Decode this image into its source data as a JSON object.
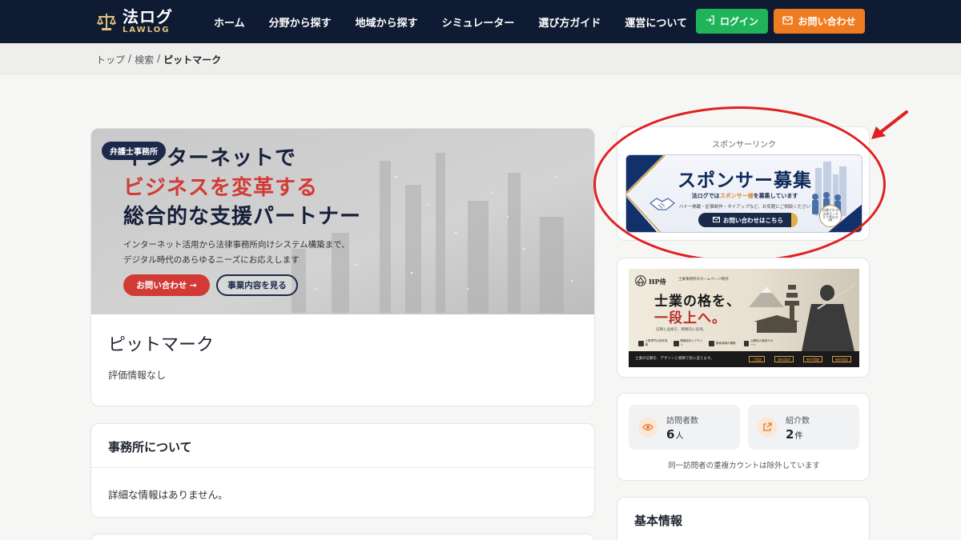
{
  "header": {
    "logo_main": "法ログ",
    "logo_sub": "LAWLOG",
    "nav": [
      "ホーム",
      "分野から探す",
      "地域から探す",
      "シミュレーター",
      "選び方ガイド",
      "運営について"
    ],
    "login_label": "ログイン",
    "contact_label": "お問い合わせ",
    "login_color": "#1fb45a",
    "contact_color": "#f07c22"
  },
  "breadcrumb": {
    "items": [
      "トップ",
      "検索"
    ],
    "current": "ピットマーク",
    "separator": "/"
  },
  "hero": {
    "badge": "弁護士事務所",
    "line1": "インターネットで",
    "line2": "ビジネスを変革する",
    "line3": "総合的な支援パートナー",
    "desc1": "インターネット活用から法律事務所向けシステム構築まで、",
    "desc2": "デジタル時代のあらゆるニーズにお応えします",
    "cta_primary": "お問い合わせ →",
    "cta_secondary": "事業内容を見る"
  },
  "office": {
    "name": "ピットマーク",
    "rating": "評価情報なし"
  },
  "about": {
    "title": "事務所について",
    "body": "詳細な情報はありません。"
  },
  "sponsor": {
    "label": "スポンサーリンク",
    "banner_title": "スポンサー募集",
    "banner_line1_pre": "法ログでは",
    "banner_line1_hl": "スポンサー様",
    "banner_line1_post": "を募集しています",
    "banner_line2": "バナー掲載・記事制作・タイアップなど、お気軽にご相談ください",
    "banner_button": "お問い合わせはこちら",
    "seal": "信頼される法律ポータルで貴社のPR"
  },
  "hp_banner": {
    "brand": "HP侍",
    "brand_sub": "士業事務所のホームページ制作",
    "headline1": "士業の格を、",
    "headline2": "一段上へ。",
    "small1": "信頼と品格を、戦略的に表現。",
    "small2": "",
    "icons": [
      "士業専門の制作実績",
      "戦略設計とデザイン",
      "集客導線の構築",
      "公開後の運用サポート"
    ],
    "footer_text": "士業の信頼を、デザインと戦略で形に変えます。",
    "tags": [
      "ご相談",
      "資料請求",
      "制作実績",
      "無料相談"
    ]
  },
  "stats": {
    "visitors_label": "訪問者数",
    "visitors_value": "6",
    "visitors_unit": "人",
    "referrals_label": "紹介数",
    "referrals_value": "2",
    "referrals_unit": "件",
    "note": "同一訪問者の重複カウントは除外しています"
  },
  "basic": {
    "title": "基本情報"
  },
  "colors": {
    "navy": "#0f1b33",
    "accent_red": "#d23a36",
    "highlight_red": "#e02020"
  }
}
